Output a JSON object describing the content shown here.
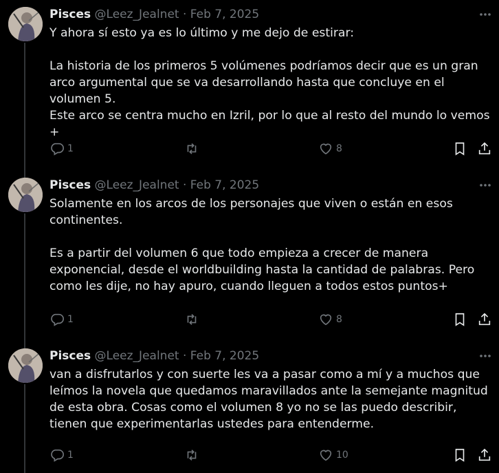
{
  "tweets": [
    {
      "name": "Pisces",
      "handle": "@Leez_Jealnet",
      "date": "Feb 7, 2025",
      "text": "Y ahora sí esto ya es lo último y me dejo de estirar:\n\nLa historia de los primeros 5 volúmenes podríamos decir que es un gran arco argumental que se va desarrollando hasta que concluye en el volumen 5.\nEste arco se centra mucho en Izril, por lo que al resto del mundo lo vemos +",
      "replies": "1",
      "retweets": "",
      "likes": "8"
    },
    {
      "name": "Pisces",
      "handle": "@Leez_Jealnet",
      "date": "Feb 7, 2025",
      "text": "Solamente en los arcos de los personajes que viven o están en esos continentes.\n\nEs a partir del volumen 6 que todo empieza a crecer de manera exponencial, desde el worldbuilding hasta la cantidad de palabras. Pero como les dije, no hay apuro, cuando lleguen a todos estos puntos+",
      "replies": "1",
      "retweets": "",
      "likes": "8"
    },
    {
      "name": "Pisces",
      "handle": "@Leez_Jealnet",
      "date": "Feb 7, 2025",
      "text": "van a disfrutarlos y con suerte les va a pasar como a mí y a muchos que leímos la novela que quedamos maravillados ante la semejante magnitud de esta obra. Cosas como el volumen 8 yo no se las puedo describir, tienen que experimentarlas ustedes para entenderme.",
      "replies": "1",
      "retweets": "",
      "likes": "10"
    }
  ],
  "separator": "·",
  "icons": {
    "reply": "reply-icon",
    "retweet": "retweet-icon",
    "like": "heart-icon",
    "bookmark": "bookmark-icon",
    "share": "share-icon",
    "more": "more-icon"
  },
  "colors": {
    "background": "#000000",
    "text": "#e7e9ea",
    "muted": "#71767b",
    "thread_line": "#333639"
  }
}
